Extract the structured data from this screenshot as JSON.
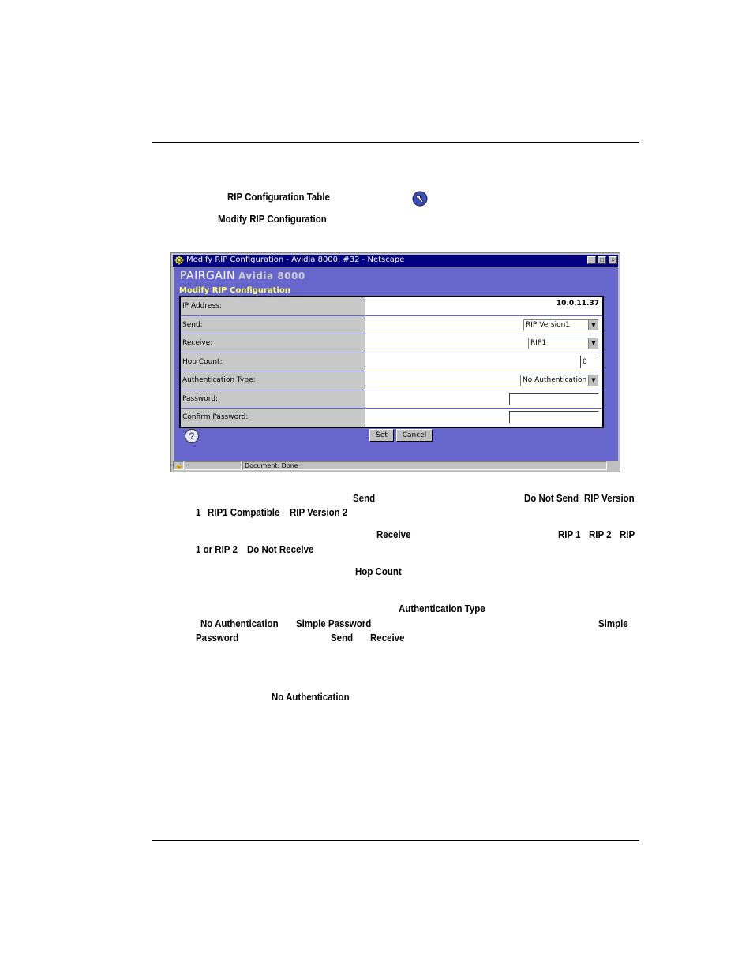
{
  "intro": {
    "table_ref": "RIP Configuration Table",
    "tool_icon": "configure-tool-icon",
    "screen_ref": "Modify RIP Configuration"
  },
  "window": {
    "title": "Modify RIP Configuration - Avidia 8000, #32 - Netscape",
    "logo_brand": "PAIRGAIN",
    "logo_model": "Avidia 8000",
    "subtitle": "Modify RIP Configuration",
    "form": {
      "ip_label": "IP Address:",
      "ip_value": "10.0.11.37",
      "send_label": "Send:",
      "send_value": "RIP Version1",
      "receive_label": "Receive:",
      "receive_value": "RIP1",
      "hop_label": "Hop Count:",
      "hop_value": "0",
      "auth_label": "Authentication Type:",
      "auth_value": "No Authentication",
      "password_label": "Password:",
      "password_value": "",
      "confirm_label": "Confirm Password:",
      "confirm_value": ""
    },
    "buttons": {
      "set": "Set",
      "cancel": "Cancel"
    },
    "status": "Document: Done"
  },
  "body": {
    "send_kw": "Send",
    "send_opt1": "Do Not Send",
    "send_opt2a": "RIP Version",
    "send_opt2b": "1",
    "send_opt3": "RIP1 Compatible",
    "send_opt4": "RIP Version 2",
    "receive_kw": "Receive",
    "recv_opt1": "RIP 1",
    "recv_opt2": "RIP 2",
    "recv_opt3a": "RIP",
    "recv_opt3b": "1 or RIP 2",
    "recv_opt4": "Do Not Receive",
    "hop_kw": "Hop Count",
    "auth_kw": "Authentication Type",
    "auth_opt1": "No Authentication",
    "auth_opt2": "Simple Password",
    "auth_simple_a": "Simple",
    "auth_simple_b": "Password",
    "auth_send": "Send",
    "auth_receive": "Receive",
    "noauth_kw": "No Authentication"
  }
}
